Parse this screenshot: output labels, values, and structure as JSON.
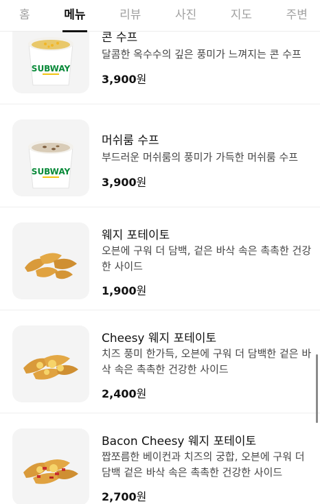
{
  "tabs": [
    {
      "label": "홈",
      "active": false
    },
    {
      "label": "메뉴",
      "active": true
    },
    {
      "label": "리뷰",
      "active": false
    },
    {
      "label": "사진",
      "active": false
    },
    {
      "label": "지도",
      "active": false
    },
    {
      "label": "주변",
      "active": false
    }
  ],
  "menu_items": [
    {
      "name": "콘 수프",
      "description": "달콤한 옥수수의 깊은 풍미가 느껴지는 콘 수프",
      "price": "3,900",
      "currency": "원",
      "image": "corn-soup-cup-image"
    },
    {
      "name": "머쉬룸 수프",
      "description": "부드러운 머쉬룸의 풍미가 가득한 머쉬룸 수프",
      "price": "3,900",
      "currency": "원",
      "image": "mushroom-soup-cup-image"
    },
    {
      "name": "웨지 포테이토",
      "description": "오븐에 구워 더 담백, 겉은 바삭 속은 촉촉한 건강한 사이드",
      "price": "1,900",
      "currency": "원",
      "image": "wedge-potato-image"
    },
    {
      "name": "Cheesy 웨지 포테이토",
      "description": "치즈 풍미 한가득, 오븐에 구워 더 담백한 겉은 바삭 속은 촉촉한 건강한 사이드",
      "price": "2,400",
      "currency": "원",
      "image": "cheesy-wedge-potato-image"
    },
    {
      "name": "Bacon Cheesy 웨지 포테이토",
      "description": "짭쪼름한 베이컨과 치즈의 궁합, 오븐에 구워 더 담백 겉은 바삭 속은 촉촉한 건강한 사이드",
      "price": "2,700",
      "currency": "원",
      "image": "bacon-cheesy-wedge-potato-image"
    }
  ],
  "cup_brand": "SUBWAY",
  "colors": {
    "brand_green": "#0a8a3a",
    "brand_yellow": "#f2c20f",
    "active_tab": "#111111",
    "inactive_tab": "#a0a0a0"
  }
}
